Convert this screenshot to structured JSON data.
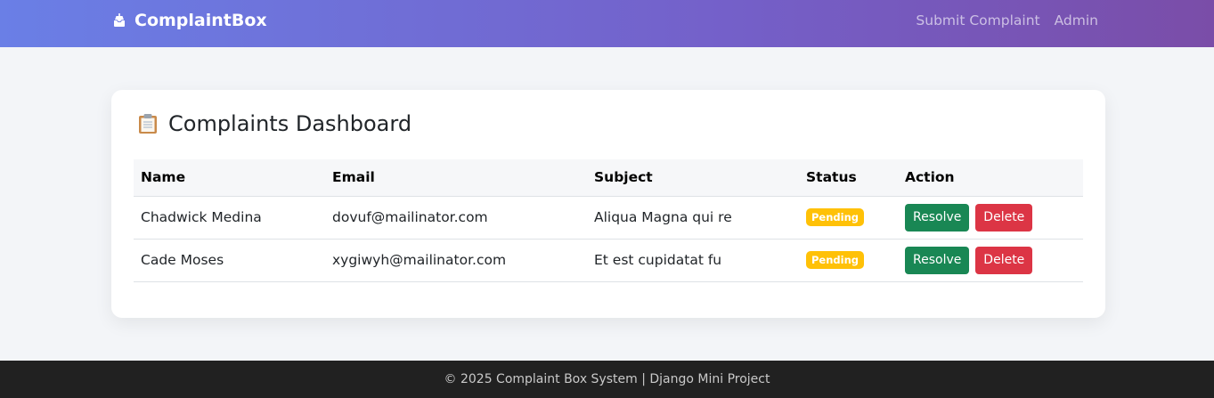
{
  "navbar": {
    "brand_label": "ComplaintBox",
    "brand_icon": "inbox-tray-icon",
    "links": [
      {
        "label": "Submit Complaint"
      },
      {
        "label": "Admin"
      }
    ]
  },
  "dashboard": {
    "title": "Complaints Dashboard",
    "title_icon": "clipboard-icon",
    "columns": [
      "Name",
      "Email",
      "Subject",
      "Status",
      "Action"
    ],
    "rows": [
      {
        "name": "Chadwick Medina",
        "email": "dovuf@mailinator.com",
        "subject": "Aliqua Magna qui re",
        "status": "Pending",
        "resolve_label": "Resolve",
        "delete_label": "Delete"
      },
      {
        "name": "Cade Moses",
        "email": "xygiwyh@mailinator.com",
        "subject": "Et est cupidatat fu",
        "status": "Pending",
        "resolve_label": "Resolve",
        "delete_label": "Delete"
      }
    ]
  },
  "colors": {
    "navbar_gradient_start": "#6a7fe6",
    "navbar_gradient_end": "#7a4da8",
    "pending_badge": "#ffc107",
    "resolve_button": "#198754",
    "delete_button": "#dc3545",
    "footer_bg": "#212121"
  },
  "footer": {
    "text": "© 2025 Complaint Box System | Django Mini Project"
  }
}
